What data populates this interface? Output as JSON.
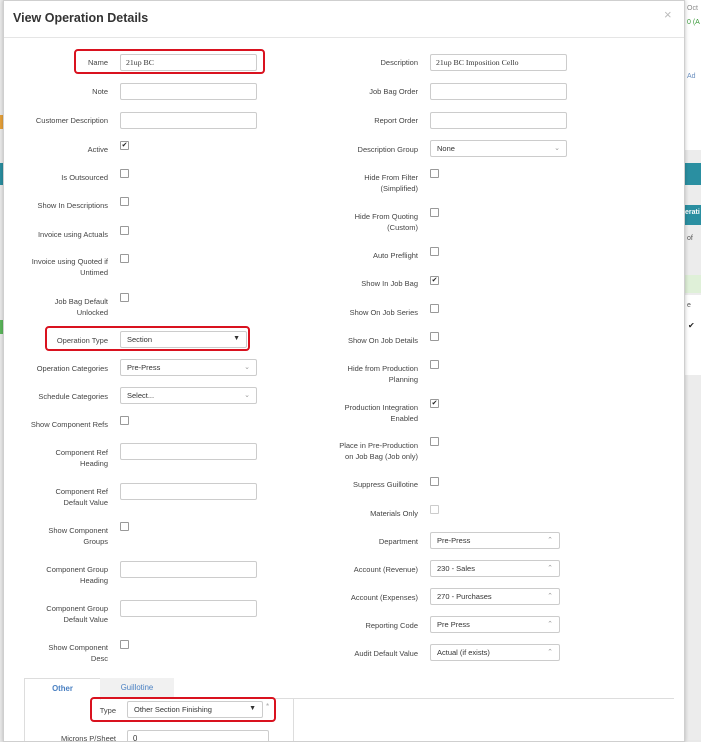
{
  "modal": {
    "title": "View Operation Details",
    "close": "×"
  },
  "left_fields": {
    "name_label": "Name",
    "name_value": "21up BC",
    "note_label": "Note",
    "note_value": "",
    "cust_desc_label": "Customer Description",
    "cust_desc_value": "",
    "active_label": "Active",
    "outsourced_label": "Is Outsourced",
    "show_in_desc_label": "Show In Descriptions",
    "invoice_actuals_label": "Invoice using Actuals",
    "invoice_quoted_label_1": "Invoice using Quoted if",
    "invoice_quoted_label_2": "Untimed",
    "bag_unlocked_label_1": "Job Bag Default",
    "bag_unlocked_label_2": "Unlocked",
    "op_type_label": "Operation Type",
    "op_type_value": "Section",
    "op_categories_label": "Operation Categories",
    "op_categories_value": "Pre-Press",
    "schedule_categories_label": "Schedule Categories",
    "schedule_categories_value": "Select...",
    "show_comp_refs_label": "Show Component Refs",
    "comp_ref_heading_label_1": "Component Ref",
    "comp_ref_heading_label_2": "Heading",
    "comp_ref_default_label_1": "Component Ref",
    "comp_ref_default_label_2": "Default Value",
    "show_comp_groups_label_1": "Show Component",
    "show_comp_groups_label_2": "Groups",
    "comp_group_heading_label_1": "Component Group",
    "comp_group_heading_label_2": "Heading",
    "comp_group_default_label_1": "Component Group",
    "comp_group_default_label_2": "Default Value",
    "show_comp_desc_label_1": "Show Component",
    "show_comp_desc_label_2": "Desc"
  },
  "right_fields": {
    "description_label": "Description",
    "description_value": "21up BC Imposition Cello",
    "job_bag_order_label": "Job Bag Order",
    "report_order_label": "Report Order",
    "desc_group_label": "Description Group",
    "desc_group_value": "None",
    "hide_filter_label_1": "Hide From Filter",
    "hide_filter_label_2": "(Simplified)",
    "hide_quoting_label_1": "Hide From Quoting",
    "hide_quoting_label_2": "(Custom)",
    "auto_preflight_label": "Auto Preflight",
    "show_in_job_bag_label": "Show In Job Bag",
    "show_on_job_series_label": "Show On Job Series",
    "show_on_job_details_label": "Show On Job Details",
    "hide_prod_planning_label_1": "Hide from Production",
    "hide_prod_planning_label_2": "Planning",
    "prod_integration_label_1": "Production Integration",
    "prod_integration_label_2": "Enabled",
    "place_preprod_label_1": "Place in Pre-Production",
    "place_preprod_label_2": "on Job Bag (Job only)",
    "suppress_guillotine_label": "Suppress Guillotine",
    "materials_only_label": "Materials Only",
    "department_label": "Department",
    "department_value": "Pre-Press",
    "acct_revenue_label": "Account (Revenue)",
    "acct_revenue_value": "230 - Sales",
    "acct_expenses_label": "Account (Expenses)",
    "acct_expenses_value": "270 - Purchases",
    "reporting_code_label": "Reporting Code",
    "reporting_code_value": "Pre Press",
    "audit_default_label": "Audit Default Value",
    "audit_default_value": "Actual (if exists)"
  },
  "tabs": {
    "other": "Other",
    "guillotine": "Guillotine"
  },
  "other_tab": {
    "type_label": "Type",
    "type_value": "Other Section Finishing",
    "type_required": "*",
    "microns_label": "Microns P/Sheet",
    "microns_value": "0"
  },
  "background": {
    "frag_1": "Oct",
    "frag_2": "0 (A",
    "frag_3": "Ad",
    "frag_4": "erati",
    "frag_5": "of",
    "frag_6": "e",
    "frag_7": "✔"
  },
  "checkbox_states": {
    "active": true,
    "is_outsourced": false,
    "show_in_descriptions": false,
    "invoice_actuals": false,
    "invoice_quoted": false,
    "bag_unlocked": false,
    "show_comp_refs": false,
    "show_comp_groups": false,
    "show_comp_desc": false,
    "hide_filter": false,
    "hide_quoting": false,
    "auto_preflight": false,
    "show_in_job_bag": true,
    "show_on_job_series": false,
    "show_on_job_details": false,
    "hide_prod_planning": false,
    "prod_integration": true,
    "place_preprod": false,
    "suppress_guillotine": false,
    "materials_only": false
  },
  "colors": {
    "highlight": "#d9121f",
    "tab_text": "#4a80c2",
    "teal_strip": "#2a8fa1",
    "green_strip": "#5cb85c"
  }
}
